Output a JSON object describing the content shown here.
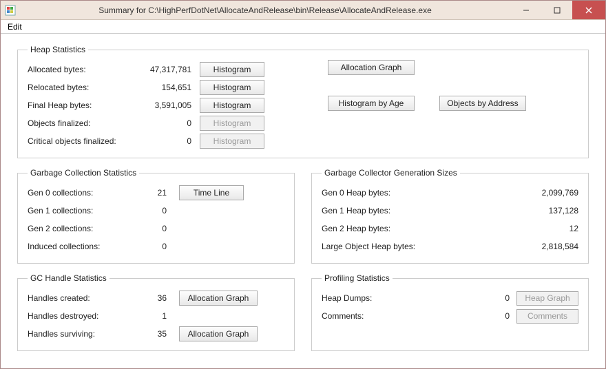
{
  "window": {
    "title": "Summary for C:\\HighPerfDotNet\\AllocateAndRelease\\bin\\Release\\AllocateAndRelease.exe"
  },
  "menu": {
    "edit": "Edit"
  },
  "heap": {
    "legend": "Heap Statistics",
    "allocated_label": "Allocated bytes:",
    "allocated_value": "47,317,781",
    "relocated_label": "Relocated bytes:",
    "relocated_value": "154,651",
    "final_label": "Final Heap bytes:",
    "final_value": "3,591,005",
    "finalized_label": "Objects finalized:",
    "finalized_value": "0",
    "critical_label": "Critical objects finalized:",
    "critical_value": "0",
    "histogram_btn": "Histogram",
    "alloc_graph_btn": "Allocation Graph",
    "hist_by_age_btn": "Histogram by Age",
    "obj_by_addr_btn": "Objects by Address"
  },
  "gc": {
    "legend": "Garbage Collection Statistics",
    "gen0_label": "Gen 0 collections:",
    "gen0_value": "21",
    "gen1_label": "Gen 1 collections:",
    "gen1_value": "0",
    "gen2_label": "Gen 2 collections:",
    "gen2_value": "0",
    "induced_label": "Induced collections:",
    "induced_value": "0",
    "timeline_btn": "Time Line"
  },
  "gen": {
    "legend": "Garbage Collector Generation Sizes",
    "g0_label": "Gen 0 Heap bytes:",
    "g0_value": "2,099,769",
    "g1_label": "Gen 1 Heap bytes:",
    "g1_value": "137,128",
    "g2_label": "Gen 2 Heap bytes:",
    "g2_value": "12",
    "loh_label": "Large Object Heap bytes:",
    "loh_value": "2,818,584"
  },
  "handle": {
    "legend": "GC Handle Statistics",
    "created_label": "Handles created:",
    "created_value": "36",
    "destroyed_label": "Handles destroyed:",
    "destroyed_value": "1",
    "surviving_label": "Handles surviving:",
    "surviving_value": "35",
    "alloc_graph_btn": "Allocation Graph"
  },
  "prof": {
    "legend": "Profiling Statistics",
    "dumps_label": "Heap Dumps:",
    "dumps_value": "0",
    "comments_label": "Comments:",
    "comments_value": "0",
    "heap_graph_btn": "Heap Graph",
    "comments_btn": "Comments"
  }
}
